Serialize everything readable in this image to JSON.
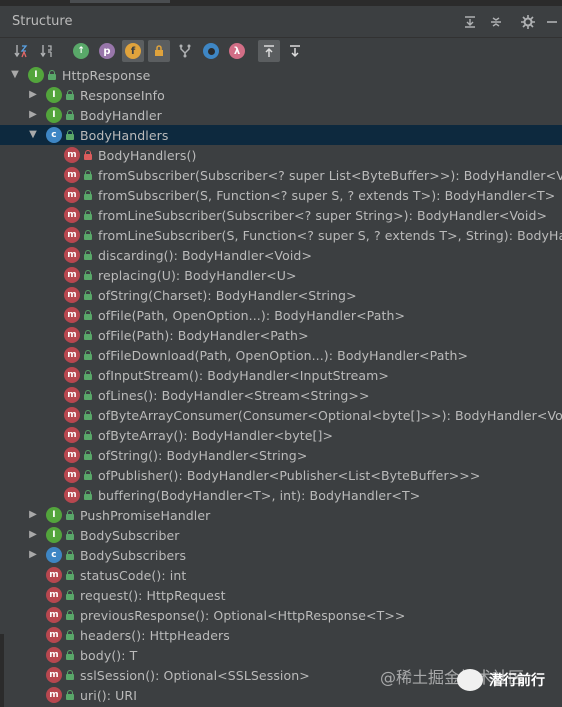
{
  "panel": {
    "title": "Structure"
  },
  "header_buttons": [
    "expand-all-icon",
    "collapse-all-icon",
    "gear-icon",
    "minimize-icon"
  ],
  "toolbar": {
    "buttons": [
      {
        "name": "sort-by-visibility-icon",
        "glyph": "↓a"
      },
      {
        "name": "sort-alphabetically-icon",
        "glyph": "↓z"
      },
      {
        "name": "show-inherited-icon",
        "glyph": "↑"
      },
      {
        "name": "show-properties-icon",
        "glyph": "p"
      },
      {
        "name": "show-fields-icon",
        "glyph": "f"
      },
      {
        "name": "show-non-public-icon",
        "glyph": "🔒"
      },
      {
        "name": "show-lambdas-icon",
        "glyph": "Y"
      },
      {
        "name": "show-anonymous-icon",
        "glyph": "○"
      },
      {
        "name": "show-lambda-icon",
        "glyph": "λ"
      },
      {
        "name": "autoscroll-to-source-icon",
        "glyph": "↥"
      },
      {
        "name": "autoscroll-from-source-icon",
        "glyph": "↧"
      }
    ]
  },
  "tree": {
    "root": "HttpResponse",
    "rows": [
      {
        "label": "HttpResponse",
        "kind": "i",
        "vis": "pub",
        "indent": 0,
        "arrow": "down"
      },
      {
        "label": "ResponseInfo",
        "kind": "i",
        "vis": "pub",
        "indent": 1,
        "arrow": "right"
      },
      {
        "label": "BodyHandler",
        "kind": "i",
        "vis": "pub",
        "indent": 1,
        "arrow": "right"
      },
      {
        "label": "BodyHandlers",
        "kind": "c",
        "vis": "pub",
        "indent": 1,
        "arrow": "down",
        "selected": true
      },
      {
        "label": "BodyHandlers()",
        "kind": "m",
        "vis": "priv",
        "indent": 2
      },
      {
        "label": "fromSubscriber(Subscriber<? super List<ByteBuffer>>): BodyHandler<Void>",
        "kind": "m",
        "vis": "pub",
        "indent": 2
      },
      {
        "label": "fromSubscriber(S, Function<? super S, ? extends T>): BodyHandler<T>",
        "kind": "m",
        "vis": "pub",
        "indent": 2
      },
      {
        "label": "fromLineSubscriber(Subscriber<? super String>): BodyHandler<Void>",
        "kind": "m",
        "vis": "pub",
        "indent": 2
      },
      {
        "label": "fromLineSubscriber(S, Function<? super S, ? extends T>, String): BodyHandler<T>",
        "kind": "m",
        "vis": "pub",
        "indent": 2
      },
      {
        "label": "discarding(): BodyHandler<Void>",
        "kind": "m",
        "vis": "pub",
        "indent": 2
      },
      {
        "label": "replacing(U): BodyHandler<U>",
        "kind": "m",
        "vis": "pub",
        "indent": 2
      },
      {
        "label": "ofString(Charset): BodyHandler<String>",
        "kind": "m",
        "vis": "pub",
        "indent": 2
      },
      {
        "label": "ofFile(Path, OpenOption...): BodyHandler<Path>",
        "kind": "m",
        "vis": "pub",
        "indent": 2
      },
      {
        "label": "ofFile(Path): BodyHandler<Path>",
        "kind": "m",
        "vis": "pub",
        "indent": 2
      },
      {
        "label": "ofFileDownload(Path, OpenOption...): BodyHandler<Path>",
        "kind": "m",
        "vis": "pub",
        "indent": 2
      },
      {
        "label": "ofInputStream(): BodyHandler<InputStream>",
        "kind": "m",
        "vis": "pub",
        "indent": 2
      },
      {
        "label": "ofLines(): BodyHandler<Stream<String>>",
        "kind": "m",
        "vis": "pub",
        "indent": 2
      },
      {
        "label": "ofByteArrayConsumer(Consumer<Optional<byte[]>>): BodyHandler<Void>",
        "kind": "m",
        "vis": "pub",
        "indent": 2
      },
      {
        "label": "ofByteArray(): BodyHandler<byte[]>",
        "kind": "m",
        "vis": "pub",
        "indent": 2
      },
      {
        "label": "ofString(): BodyHandler<String>",
        "kind": "m",
        "vis": "pub",
        "indent": 2
      },
      {
        "label": "ofPublisher(): BodyHandler<Publisher<List<ByteBuffer>>>",
        "kind": "m",
        "vis": "pub",
        "indent": 2
      },
      {
        "label": "buffering(BodyHandler<T>, int): BodyHandler<T>",
        "kind": "m",
        "vis": "pub",
        "indent": 2
      },
      {
        "label": "PushPromiseHandler",
        "kind": "i",
        "vis": "pub",
        "indent": 1,
        "arrow": "right"
      },
      {
        "label": "BodySubscriber",
        "kind": "i",
        "vis": "pub",
        "indent": 1,
        "arrow": "right"
      },
      {
        "label": "BodySubscribers",
        "kind": "c",
        "vis": "pub",
        "indent": 1,
        "arrow": "right"
      },
      {
        "label": "statusCode(): int",
        "kind": "m",
        "vis": "pub",
        "indent": 1
      },
      {
        "label": "request(): HttpRequest",
        "kind": "m",
        "vis": "pub",
        "indent": 1
      },
      {
        "label": "previousResponse(): Optional<HttpResponse<T>>",
        "kind": "m",
        "vis": "pub",
        "indent": 1
      },
      {
        "label": "headers(): HttpHeaders",
        "kind": "m",
        "vis": "pub",
        "indent": 1
      },
      {
        "label": "body(): T",
        "kind": "m",
        "vis": "pub",
        "indent": 1
      },
      {
        "label": "sslSession(): Optional<SSLSession>",
        "kind": "m",
        "vis": "pub",
        "indent": 1
      },
      {
        "label": "uri(): URI",
        "kind": "m",
        "vis": "pub",
        "indent": 1
      }
    ]
  },
  "watermark": {
    "text": "@稀土掘金技术社区",
    "brand": "潜行前行"
  },
  "colors": {
    "background": "#3c3f41",
    "selection": "#0d293e",
    "method": "#b7474f",
    "interface": "#53a53c",
    "class": "#3e86c4"
  }
}
